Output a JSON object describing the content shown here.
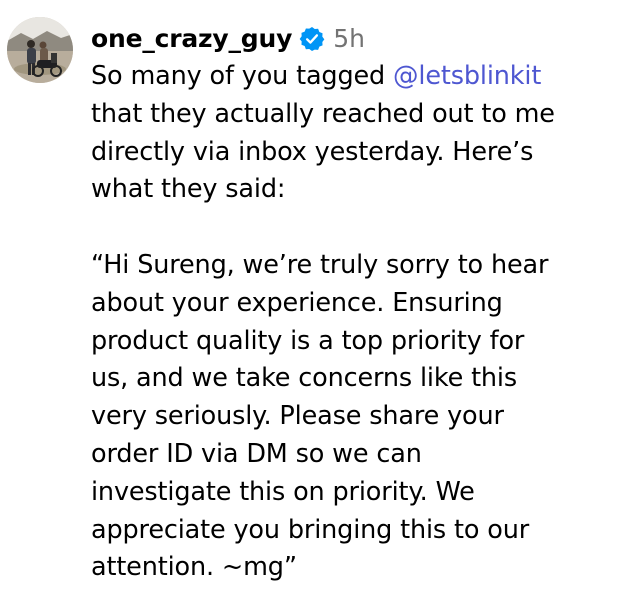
{
  "comment": {
    "avatar_icon": "user-avatar",
    "username": "one_crazy_guy",
    "verified_icon": "verified-badge-icon",
    "verified_color": "#0095f6",
    "timestamp": "5h",
    "paragraph1": {
      "prefix": "So many of you tagged ",
      "mention": "@letsblinkit",
      "line2": "that they actually reached out to me",
      "line3": "directly via inbox yesterday. Here’s",
      "line4": "what they said:"
    },
    "paragraph2": {
      "line1": "“Hi Sureng, we’re truly sorry to hear",
      "line2": "about your experience. Ensuring",
      "line3": "product quality is a top priority for",
      "line4": "us, and we take concerns like this",
      "line5": "very seriously. Please share your",
      "line6": "order ID via DM so we can",
      "line7": "investigate this on priority. We",
      "line8": "appreciate you bringing this to our",
      "line9": "attention. ~mg”"
    },
    "mention_color": "#4e57d1"
  }
}
